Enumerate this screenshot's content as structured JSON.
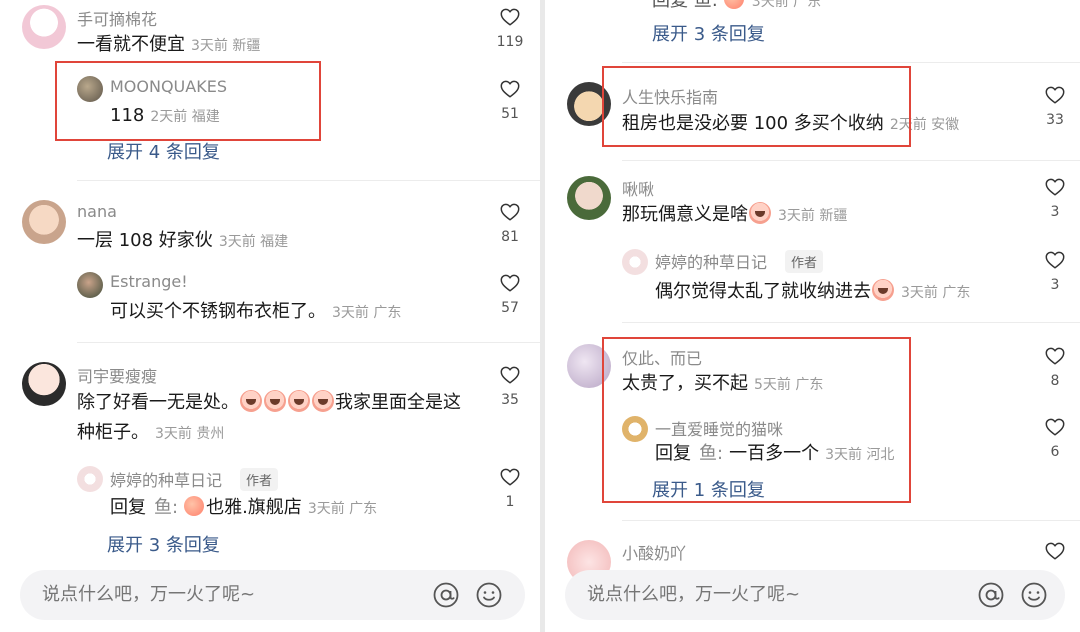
{
  "input_placeholder": "说点什么吧，万一火了呢~",
  "expand_prefix": "展开",
  "expand_suffix": "条回复",
  "reply_prefix": "回复",
  "author_tag": "作者",
  "left": {
    "c1": {
      "user": "手可摘棉花",
      "text": "一看就不便宜",
      "meta": "3天前 新疆",
      "likes": "119"
    },
    "r1": {
      "user": "MOONQUAKES",
      "text": "118",
      "meta": "2天前 福建",
      "likes": "51"
    },
    "expand1": {
      "count": "4"
    },
    "c2": {
      "user": "nana",
      "text": "一层 108 好家伙",
      "meta": "3天前 福建",
      "likes": "81"
    },
    "r2": {
      "user": "Estrange!",
      "text": "可以买个不锈钢布衣柜了。",
      "meta": "3天前 广东",
      "likes": "57"
    },
    "c3": {
      "user": "司宇要瘦瘦",
      "text_a": "除了好看一无是处。",
      "text_b": "我家里面全是这",
      "text_c": "种柜子。",
      "meta": "3天前 贵州",
      "likes": "35"
    },
    "r3": {
      "user": "婷婷的种草日记",
      "reply_to": "鱼:",
      "text": "也雅.旗舰店",
      "meta": "3天前 广东",
      "likes": "1"
    },
    "expand3": {
      "count": "3"
    }
  },
  "right": {
    "top_reply": {
      "text": "回复 鱼:",
      "meta": "3天前 广东"
    },
    "expand0": {
      "count": "3"
    },
    "c1": {
      "user": "人生快乐指南",
      "text": "租房也是没必要 100 多买个收纳",
      "meta": "2天前 安徽",
      "likes": "33"
    },
    "c2": {
      "user": "啾啾",
      "text": "那玩偶意义是啥",
      "meta": "3天前 新疆",
      "likes": "3"
    },
    "r2": {
      "user": "婷婷的种草日记",
      "text": "偶尔觉得太乱了就收纳进去",
      "meta": "3天前 广东",
      "likes": "3"
    },
    "c3": {
      "user": "仅此、而已",
      "text": "太贵了，买不起",
      "meta": "5天前 广东",
      "likes": "8"
    },
    "r3": {
      "user": "一直爱睡觉的猫咪",
      "reply_to": "鱼:",
      "text": "一百多一个",
      "meta": "3天前 河北",
      "likes": "6"
    },
    "expand3": {
      "count": "1"
    },
    "c4": {
      "user": "小酸奶吖"
    }
  },
  "colors": {
    "highlight_box": "#e0453a",
    "expand_link": "#3a5a8a"
  }
}
